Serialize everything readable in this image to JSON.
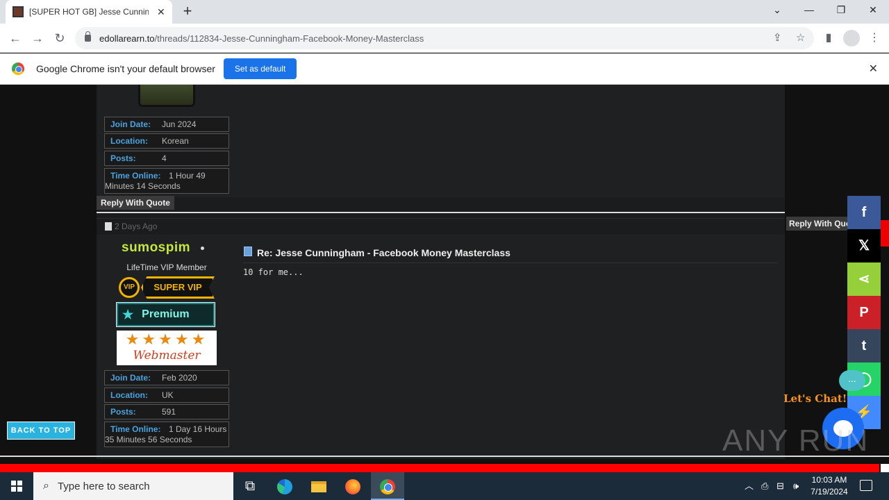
{
  "browser": {
    "tab_title": "[SUPER HOT GB] Jesse Cunningham - Facebook Money Masterclass",
    "tab_close": "✕",
    "new_tab": "+",
    "url_domain": "edollarearn.to",
    "url_path": "/threads/112834-Jesse-Cunningham-Facebook-Money-Masterclass",
    "infobar_text": "Google Chrome isn't your default browser",
    "infobar_button": "Set as default",
    "infobar_close": "✕"
  },
  "post1": {
    "fields": [
      {
        "label": "Join Date:",
        "value": "Jun 2024"
      },
      {
        "label": "Location:",
        "value": "Korean"
      },
      {
        "label": "Posts:",
        "value": "4"
      },
      {
        "label": "Time Online:",
        "value": "1 Hour 49",
        "value2": "Minutes 14 Seconds"
      }
    ],
    "reply_with_quote": "Reply With Quote"
  },
  "post2": {
    "date": "2 Days Ago",
    "username": "sumospim",
    "user_title": "LifeTime VIP Member",
    "badges": {
      "vip_circle": "VIP",
      "vip_ribbon": "SUPER VIP",
      "premium": "Premium",
      "webmaster_stars": "★★★★★",
      "webmaster": "Webmaster"
    },
    "title": "Re: Jesse Cunningham - Facebook Money Masterclass",
    "body": "10 for me...",
    "fields": [
      {
        "label": "Join Date:",
        "value": "Feb 2020"
      },
      {
        "label": "Location:",
        "value": "UK"
      },
      {
        "label": "Posts:",
        "value": "591"
      },
      {
        "label": "Time Online:",
        "value": "1 Day 16 Hours",
        "value2": "35 Minutes 56 Seconds"
      }
    ]
  },
  "page": {
    "back_to_top": "BACK TO TOP",
    "reply_with_quote_right": "Reply With Quote",
    "chat_dots": "...",
    "lets_chat": "Let's Chat!",
    "watermark": "ANY RUN"
  },
  "share": [
    {
      "icon": "facebook-icon",
      "glyph": "f",
      "color": "#3b5998"
    },
    {
      "icon": "x-icon",
      "glyph": "𝕏",
      "color": "#000000"
    },
    {
      "icon": "share-icon",
      "glyph": "⋖",
      "color": "#95d03a"
    },
    {
      "icon": "pinterest-icon",
      "glyph": "P",
      "color": "#cb2027"
    },
    {
      "icon": "tumblr-icon",
      "glyph": "t",
      "color": "#35465c"
    },
    {
      "icon": "whatsapp-icon",
      "glyph": "◯",
      "color": "#25d366"
    },
    {
      "icon": "messenger-icon",
      "glyph": "⚡",
      "color": "#448aff"
    }
  ],
  "taskbar": {
    "search_placeholder": "Type here to search",
    "time": "10:03 AM",
    "date": "7/19/2024"
  }
}
